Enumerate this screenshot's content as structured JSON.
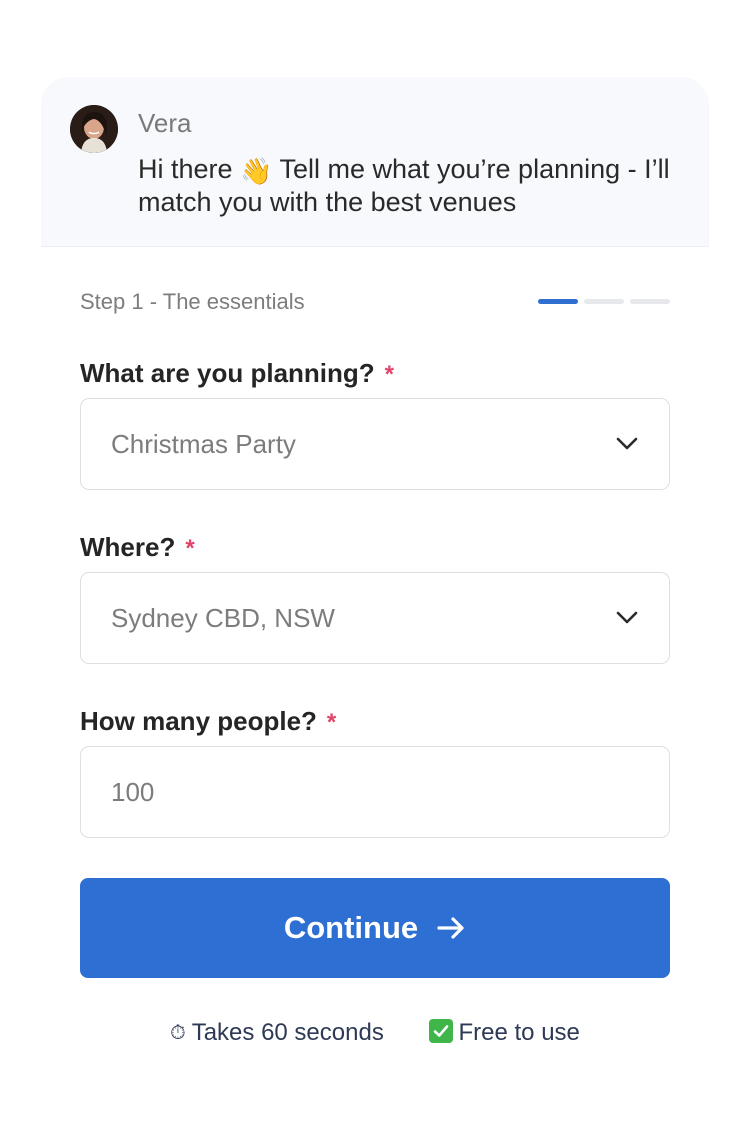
{
  "chat": {
    "agent_name": "Vera",
    "greeting_before_emoji": "Hi there",
    "wave_emoji": "👋",
    "greeting_after_emoji": "Tell me what you’re planning - I’ll match you with the best venues"
  },
  "step": {
    "label": "Step 1 - The essentials",
    "current": 1,
    "total": 3
  },
  "fields": {
    "event_type": {
      "label": "What are you planning?",
      "required_mark": "*",
      "value": "Christmas Party"
    },
    "location": {
      "label": "Where?",
      "required_mark": "*",
      "value": "Sydney CBD, NSW"
    },
    "people": {
      "label": "How many people?",
      "required_mark": "*",
      "placeholder": "100"
    }
  },
  "continue_button": {
    "label": "Continue"
  },
  "footer": {
    "timer_emoji": "⏱",
    "duration_text": "Takes 60 seconds",
    "free_text": "Free to use"
  },
  "colors": {
    "accent": "#2d6fd2",
    "required": "#e0446a",
    "check": "#3fb54a"
  },
  "icons": {
    "avatar": "avatar-photo",
    "dropdown": "chevron-down-icon",
    "continue": "arrow-right-icon",
    "timer": "stopwatch-icon",
    "free": "check-mark-icon"
  }
}
